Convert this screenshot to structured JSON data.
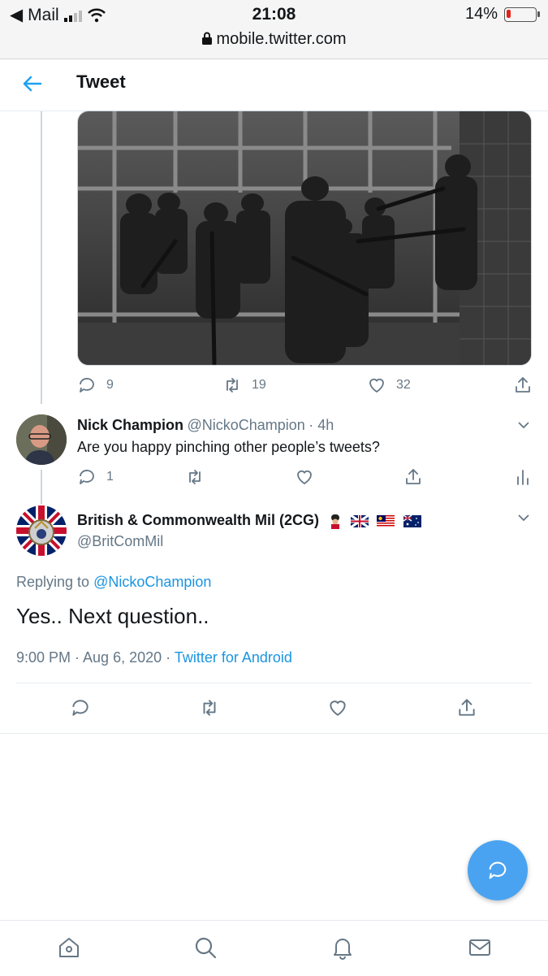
{
  "status_bar": {
    "back_app": "Mail",
    "time": "21:08",
    "battery": "14%",
    "url": "mobile.twitter.com"
  },
  "header": {
    "title": "Tweet"
  },
  "parent_tweet": {
    "replies": "9",
    "retweets": "19",
    "likes": "32"
  },
  "reply_tweet": {
    "name": "Nick Champion",
    "handle": "@NickoChampion",
    "time": "· 4h",
    "text": "Are you happy pinching other people’s tweets?",
    "replies": "1"
  },
  "main_tweet": {
    "name": "British & Commonwealth Mil (2CG)",
    "handle": "@BritComMil",
    "replying_prefix": "Replying to",
    "replying_to": "@NickoChampion",
    "text": "Yes.. Next question..",
    "timestamp": "9:00 PM · Aug 6, 2020 ·",
    "source": "Twitter for Android"
  },
  "colors": {
    "accent": "#1da1f2",
    "fab": "#4aa3f0",
    "muted": "#657786"
  },
  "icons": [
    "back-arrow-icon",
    "reply-icon",
    "retweet-icon",
    "like-icon",
    "share-icon",
    "analytics-icon",
    "compose-icon",
    "home-icon",
    "search-icon",
    "notifications-icon",
    "messages-icon",
    "chevron-down-icon"
  ]
}
